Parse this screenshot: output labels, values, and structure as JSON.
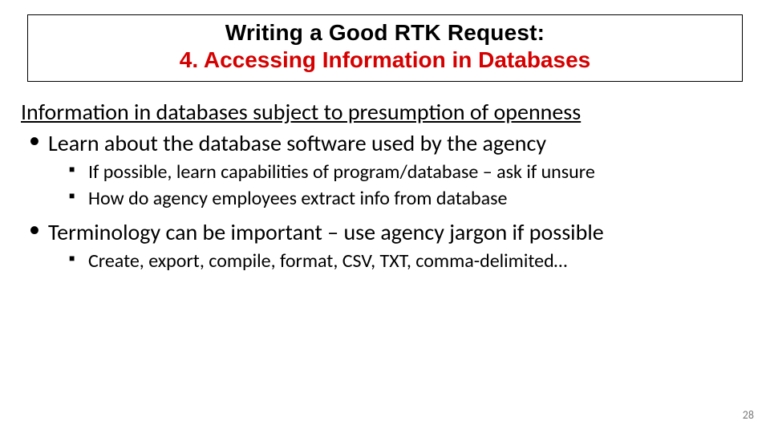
{
  "title": {
    "line1": "Writing a Good RTK Request:",
    "line2": "4. Accessing Information in Databases"
  },
  "lead": "Information in databases subject to presumption of openness",
  "bullets": [
    {
      "text": "Learn about the database software used by the agency",
      "sub": [
        "If possible, learn capabilities of program/database – ask if unsure",
        "How do agency employees extract info from database"
      ]
    },
    {
      "text": "Terminology can be important – use agency jargon if possible",
      "sub": [
        "Create, export, compile, format, CSV, TXT, comma-delimited…"
      ]
    }
  ],
  "page_number": "28"
}
